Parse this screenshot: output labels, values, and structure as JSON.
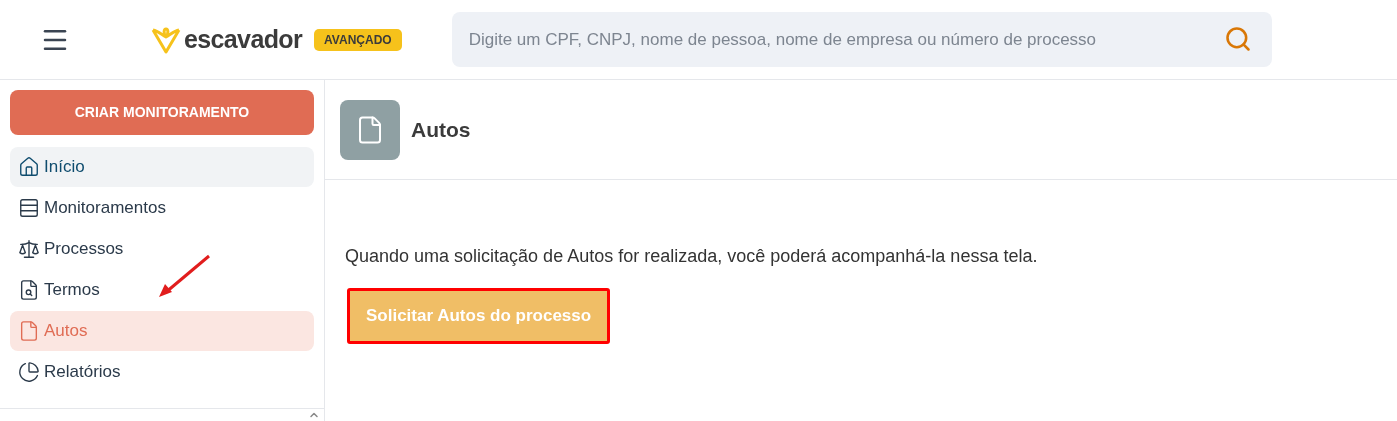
{
  "header": {
    "logo_text": "escavador",
    "plan_badge": "AVANÇADO",
    "search": {
      "placeholder": "Digite um CPF, CNPJ, nome de pessoa, nome de empresa ou número de processo"
    }
  },
  "sidebar": {
    "create_button": "CRIAR MONITORAMENTO",
    "items": [
      {
        "label": "Início",
        "selected": false,
        "hovered": true
      },
      {
        "label": "Monitoramentos",
        "selected": false,
        "hovered": false
      },
      {
        "label": "Processos",
        "selected": false,
        "hovered": false
      },
      {
        "label": "Termos",
        "selected": false,
        "hovered": false
      },
      {
        "label": "Autos",
        "selected": true,
        "hovered": false
      },
      {
        "label": "Relatórios",
        "selected": false,
        "hovered": false
      }
    ]
  },
  "page": {
    "title": "Autos",
    "message": "Quando uma solicitação de Autos for realizada, você poderá acompanhá-la nessa tela.",
    "action_button": {
      "label": "Solicitar Autos do processo",
      "highlighted": true
    }
  }
}
